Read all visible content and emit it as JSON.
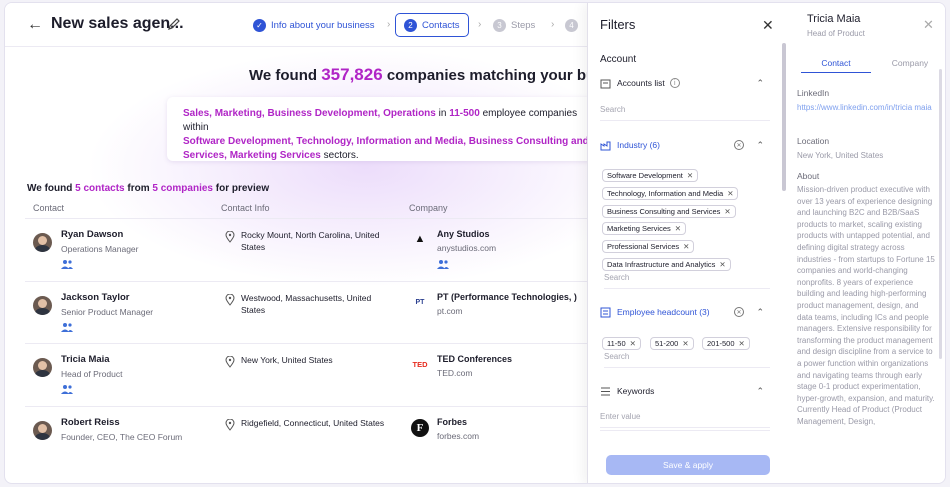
{
  "header": {
    "title": "New sales agen...",
    "steps": [
      {
        "label": "Info about your business",
        "num": "✓"
      },
      {
        "label": "Contacts",
        "num": "2"
      },
      {
        "label": "Steps",
        "num": "3"
      },
      {
        "label": "",
        "num": "4"
      }
    ]
  },
  "main": {
    "headline_pre": "We found ",
    "headline_num": "357,826",
    "headline_post": " companies matching your business",
    "summary": {
      "line1_hl": "Sales, Marketing, Business Development, Operations",
      "line1_mid": " in ",
      "line1_size": "11-500",
      "line1_post": " employee companies within",
      "line2_hl": "Software Development, Technology, Information and Media, Business Consulting and",
      "line3_hl": "Services, Marketing Services",
      "line3_post": " sectors."
    },
    "preview": {
      "pre": "We found ",
      "contacts": "5 contacts",
      "mid": " from ",
      "companies": "5 companies",
      "post": " for preview"
    },
    "columns": [
      "Contact",
      "Contact Info",
      "Company"
    ],
    "rows": [
      {
        "name": "Ryan Dawson",
        "role": "Operations Manager",
        "location": "Rocky Mount, North Carolina, United States",
        "company": "Any Studios",
        "domain": "anystudios.com",
        "logo": "▲"
      },
      {
        "name": "Jackson Taylor",
        "role": "Senior Product Manager",
        "location": "Westwood, Massachusetts, United States",
        "company": "PT (Performance Technologies, )",
        "domain": "pt.com",
        "logo": "PT"
      },
      {
        "name": "Tricia Maia",
        "role": "Head of Product",
        "location": "New York, United States",
        "company": "TED Conferences",
        "domain": "TED.com",
        "logo": "TED"
      },
      {
        "name": "Robert Reiss",
        "role": "Founder, CEO, The CEO Forum",
        "location": "Ridgefield, Connecticut, United States",
        "company": "Forbes",
        "domain": "forbes.com",
        "logo": "F"
      }
    ]
  },
  "filters": {
    "title": "Filters",
    "section": "Account",
    "accounts_list": {
      "label": "Accounts list",
      "search_placeholder": "Search"
    },
    "industry": {
      "label": "Industry (6)",
      "chips": [
        "Software Development",
        "Technology, Information and Media",
        "Business Consulting and Services",
        "Marketing Services",
        "Professional Services",
        "Data Infrastructure and Analytics"
      ],
      "search_placeholder": "Search"
    },
    "headcount": {
      "label": "Employee headcount (3)",
      "chips": [
        "11-50",
        "51-200",
        "201-500"
      ],
      "search_placeholder": "Search"
    },
    "keywords": {
      "label": "Keywords",
      "placeholder": "Enter value"
    },
    "apply": "Save & apply"
  },
  "contact_panel": {
    "name": "Tricia Maia",
    "role": "Head of Product",
    "tabs": [
      "Contact",
      "Company"
    ],
    "linkedin_label": "LinkedIn",
    "linkedin_url": "https://www.linkedin.com/in/tricia maia",
    "location_label": "Location",
    "location": "New York, United States",
    "about_label": "About",
    "about": "Mission-driven product executive with over 13 years of experience designing and launching B2C and B2B/SaaS products to market, scaling existing products with untapped potential, and defining digital strategy across industries - from startups to Fortune 15 companies and world-changing nonprofits. 8 years of experience building and leading high-performing product management, design, and data teams, including ICs and people managers. Extensive responsibility for transforming the product management and design discipline from a service to a power function within organizations and navigating teams through early stage 0-1 product experimentation, hyper-growth, expansion, and maturity. Currently Head of Product (Product Management, Design,"
  }
}
